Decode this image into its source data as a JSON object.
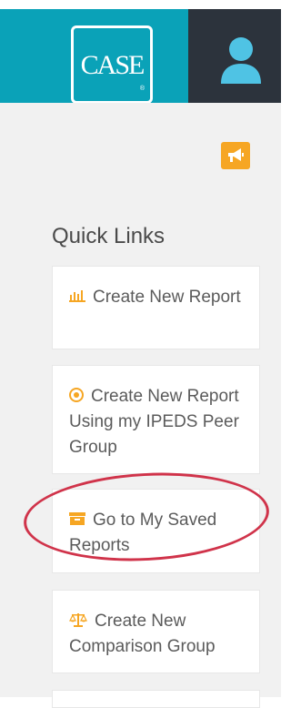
{
  "header": {
    "logo_text": "CASE",
    "logo_reg": "®"
  },
  "sidebar": {
    "quick_links_title": "Quick Links",
    "links": [
      {
        "label": "Create New Report",
        "icon": "bar-chart-icon"
      },
      {
        "label": "Create New Report Using my IPEDS Peer Group",
        "icon": "target-icon"
      },
      {
        "label": "Go to My Saved Reports",
        "icon": "archive-box-icon"
      },
      {
        "label": "Create New Comparison Group",
        "icon": "balance-scale-icon"
      }
    ]
  },
  "colors": {
    "brand_teal": "#0aa2b8",
    "dark_bar": "#2c333c",
    "accent_orange": "#f6a623",
    "highlight_red": "#d0334a"
  }
}
